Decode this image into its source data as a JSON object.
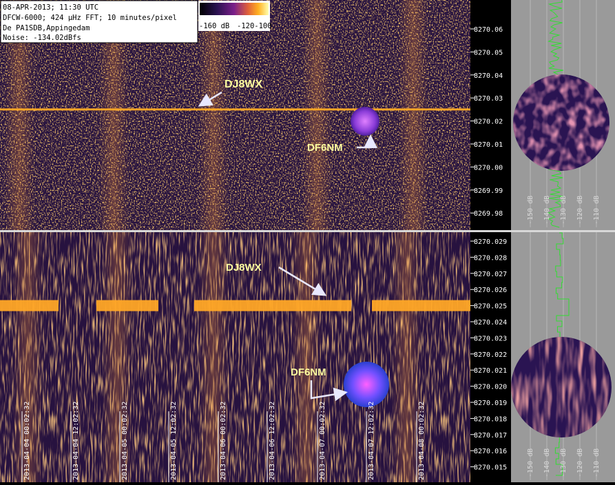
{
  "info": {
    "line1": "08-APR-2013; 11:30 UTC",
    "line2": "DFCW-6000; 424 µHz FFT; 10 minutes/pixel",
    "line3": "De PA1SDB,Appingedam",
    "line4": "Noise: -134.02dBfs"
  },
  "colorbar": {
    "label_left": "-160 dB",
    "label_right": "-120-100"
  },
  "annotations": {
    "top_dj8wx": "DJ8WX",
    "top_df6nm": "DF6NM",
    "bottom_dj8wx": "DJ8WX",
    "bottom_df6nm": "DF6NM"
  },
  "colors": {
    "background": "#25113f",
    "signal": "#ffa726",
    "trace": "#33dd33",
    "side_panel": "#9a9a9a"
  },
  "chart_data": [
    {
      "type": "heatmap",
      "title": "",
      "xlabel": "",
      "ylabel": "",
      "freq_ticks": [
        "8270.06",
        "8270.05",
        "8270.04",
        "8270.03",
        "8270.02",
        "8270.01",
        "8270.00",
        "8269.99",
        "8269.98"
      ],
      "ylim": [
        8269.97,
        8270.07
      ],
      "signal_freq": 8270.025,
      "side_axis_labels": [
        "-150 dB",
        "-140 dB",
        "-130 dB",
        "-120 dB",
        "-110 dB"
      ]
    },
    {
      "type": "heatmap",
      "title": "",
      "xlabel": "",
      "ylabel": "",
      "freq_ticks": [
        "8270.029",
        "8270.028",
        "8270.027",
        "8270.026",
        "8270.025",
        "8270.024",
        "8270.023",
        "8270.022",
        "8270.021",
        "8270.020",
        "8270.019",
        "8270.018",
        "8270.017",
        "8270.016",
        "8270.015"
      ],
      "ylim": [
        8270.0145,
        8270.0295
      ],
      "signal_freq": 8270.025,
      "time_labels": [
        "2013-04-04 00:02:32",
        "2013-04-04 12:02:32",
        "2013-04-05 00:02:32",
        "2013-04-05 12:02:32",
        "2013-04-06 00:02:32",
        "2013-04-06 12:02:32",
        "2013-04-07 00:02:32",
        "2013-04-07 12:02:32",
        "2013-04-08 00:02:32"
      ],
      "side_axis_labels": [
        "-150 dB",
        "-140 dB",
        "-130 dB",
        "-120 dB",
        "-110 dB"
      ]
    }
  ]
}
